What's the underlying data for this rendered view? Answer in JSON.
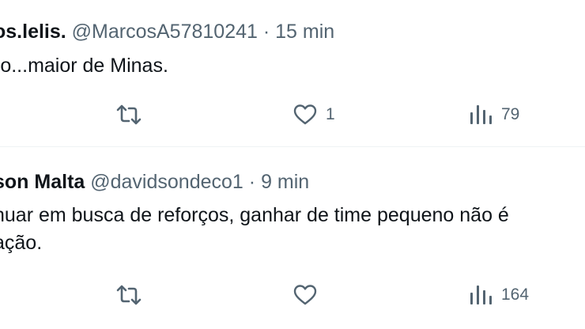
{
  "tweets": [
    {
      "name": "os.lelis.",
      "handle": "@MarcosA57810241",
      "separator": "·",
      "time": "15 min",
      "lines": [
        "ro...maior de Minas."
      ],
      "actions": {
        "retweets": "",
        "likes": "1",
        "views": "79"
      }
    },
    {
      "name": "son Malta",
      "handle": "@davidsondeco1",
      "separator": "·",
      "time": "9 min",
      "lines": [
        "nuar em busca de reforços, ganhar de time pequeno não é",
        "ação."
      ],
      "actions": {
        "retweets": "",
        "likes": "",
        "views": "164"
      }
    }
  ],
  "icons": {
    "retweet": "retweet-icon",
    "like": "heart-icon",
    "views": "views-icon"
  },
  "colors": {
    "text": "#0f1419",
    "secondary": "#536471",
    "divider": "#eff3f4"
  }
}
